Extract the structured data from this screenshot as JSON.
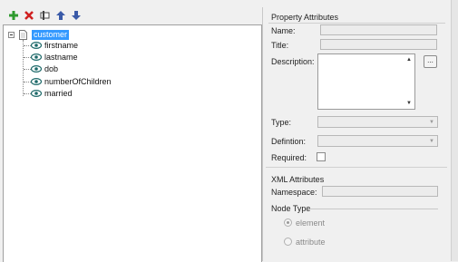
{
  "toolbar": {
    "buttons": [
      {
        "icon": "add-icon",
        "color": "#2e9a2e"
      },
      {
        "icon": "delete-icon",
        "color": "#d02020"
      },
      {
        "icon": "rename-icon",
        "color": "#555555"
      },
      {
        "icon": "move-up-icon",
        "color": "#3a5aa8"
      },
      {
        "icon": "move-down-icon",
        "color": "#3a5aa8"
      }
    ]
  },
  "tree": {
    "root": {
      "label": "customer",
      "selected": true
    },
    "children": [
      {
        "label": "firstname"
      },
      {
        "label": "lastname"
      },
      {
        "label": "dob"
      },
      {
        "label": "numberOfChildren"
      },
      {
        "label": "married"
      }
    ]
  },
  "property_attributes": {
    "title": "Property Attributes",
    "name_label": "Name:",
    "title_label": "Title:",
    "description_label": "Description:",
    "ellipsis": "...",
    "type_label": "Type:",
    "definition_label": "Defintion:",
    "required_label": "Required:"
  },
  "xml_attributes": {
    "title": "XML Attributes",
    "namespace_label": "Namespace:",
    "node_type_label": "Node Type",
    "options": [
      {
        "label": "element",
        "checked": true
      },
      {
        "label": "attribute",
        "checked": false
      }
    ]
  },
  "colors": {
    "selection": "#3399ff",
    "panel_bg": "#f0f0f0"
  }
}
